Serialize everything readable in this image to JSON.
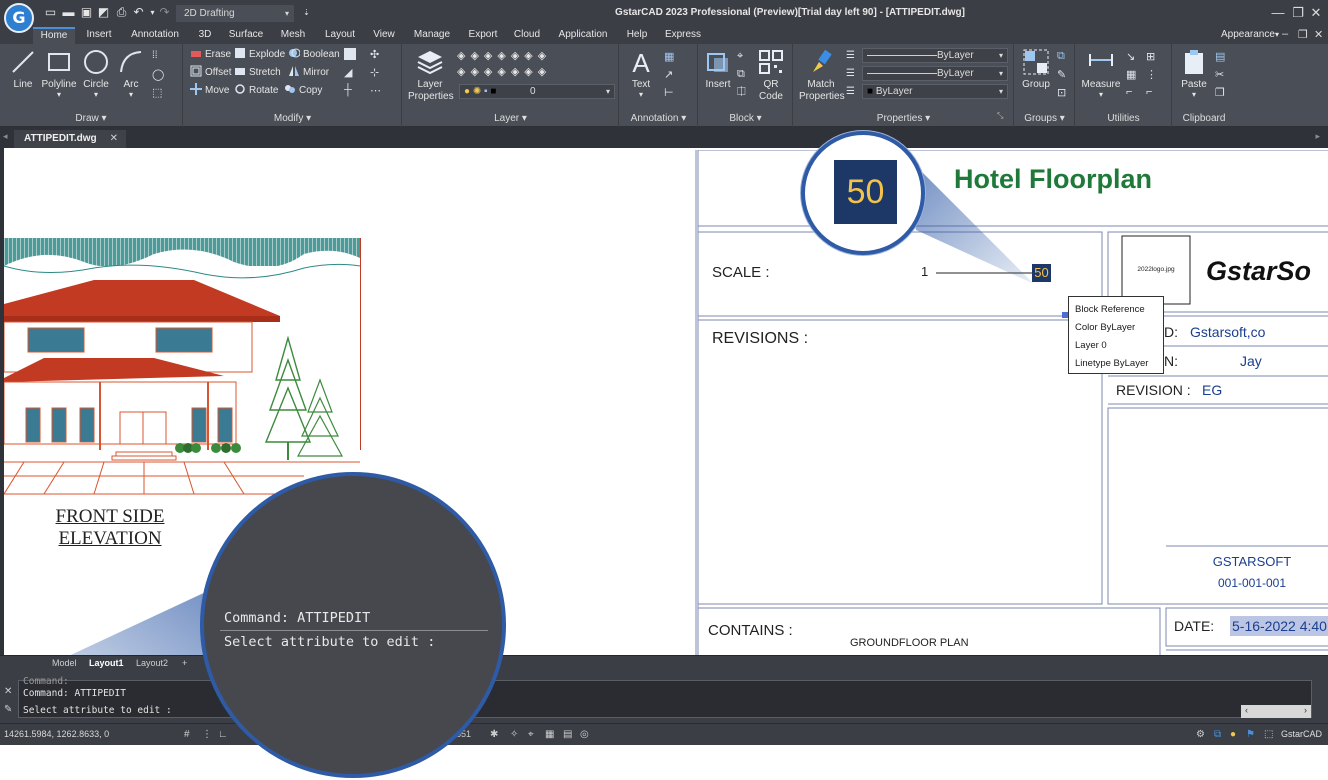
{
  "titlebar": {
    "logo_letter": "G",
    "workspace": "2D Drafting",
    "window_title": "GstarCAD 2023 Professional (Preview)[Trial day left 90] - [ATTIPEDIT.dwg]"
  },
  "tabs": [
    "Home",
    "Insert",
    "Annotation",
    "3D",
    "Surface",
    "Mesh",
    "Layout",
    "View",
    "Manage",
    "Export",
    "Cloud",
    "Application",
    "Help",
    "Express"
  ],
  "appearance_label": "Appearance",
  "ribbon": {
    "draw": {
      "title": "Draw",
      "buttons": [
        "Line",
        "Polyline",
        "Circle",
        "Arc"
      ]
    },
    "modify": {
      "title": "Modify",
      "buttons": [
        "Erase",
        "Explode",
        "Boolean",
        "Offset",
        "Stretch",
        "Mirror",
        "Move",
        "Rotate",
        "Copy"
      ]
    },
    "layer": {
      "title": "Layer",
      "big": "Layer Properties",
      "layer_value": "0"
    },
    "annotation": {
      "title": "Annotation",
      "big": "Text"
    },
    "block": {
      "title": "Block",
      "insert": "Insert",
      "qr": "QR Code"
    },
    "properties": {
      "title": "Properties",
      "match": "Match Properties",
      "color": "ByLayer",
      "linetype": "ByLayer",
      "lineweight": "ByLayer"
    },
    "groups": {
      "title": "Groups",
      "big": "Group"
    },
    "utilities": {
      "title": "Utilities",
      "big": "Measure"
    },
    "clipboard": {
      "title": "Clipboard",
      "big": "Paste"
    }
  },
  "file_tab": "ATTIPEDIT.dwg",
  "drawing": {
    "elevation_title_1": "FRONT SIDE",
    "elevation_title_2": "ELEVATION",
    "project_title": "Hotel Floorplan",
    "scale_label": "SCALE :",
    "scale_left": "1",
    "scale_right": "50",
    "revisions_label": "REVISIONS :",
    "logo_placeholder": "2022logo.jpg",
    "company_short": "GstarSo",
    "field_d_label": "D:",
    "field_d_value": "Gstarsoft,co",
    "field_n_label": "N:",
    "field_n_value": "Jay",
    "revision_label": "REVISION :",
    "revision_value": "EG",
    "company_name": "GSTARSOFT",
    "company_code": "001-001-001",
    "contains_label": "CONTAINS :",
    "contains_value": "GROUNDFLOOR PLAN",
    "date_label": "DATE:",
    "date_value": "5-16-2022 4:40"
  },
  "tooltip": {
    "title": "Block Reference",
    "color": "Color  ByLayer",
    "layer": "Layer  0",
    "linetype": "Linetype  ByLayer"
  },
  "zoom_top_value": "50",
  "layout_tabs": [
    "Model",
    "Layout1",
    "Layout2",
    "+"
  ],
  "command": {
    "history_top": "Command:",
    "line1": "Command: ATTIPEDIT",
    "line2": "Select attribute to edit :"
  },
  "zoom_bottom": {
    "line1": "Command: ATTIPEDIT",
    "line2": "Select attribute to edit :"
  },
  "status": {
    "coords": "14261.5984, 1262.8633, 0",
    "partial": "651",
    "app": "GstarCAD"
  },
  "colors": {
    "chrome": "#3b3e45",
    "ribbon": "#4a4e56",
    "accent": "#2e5aa6",
    "title_green": "#1f7a3a",
    "value_blue": "#1a3f8f",
    "roof_red": "#c23a22",
    "tree_green": "#3c8a3c"
  }
}
